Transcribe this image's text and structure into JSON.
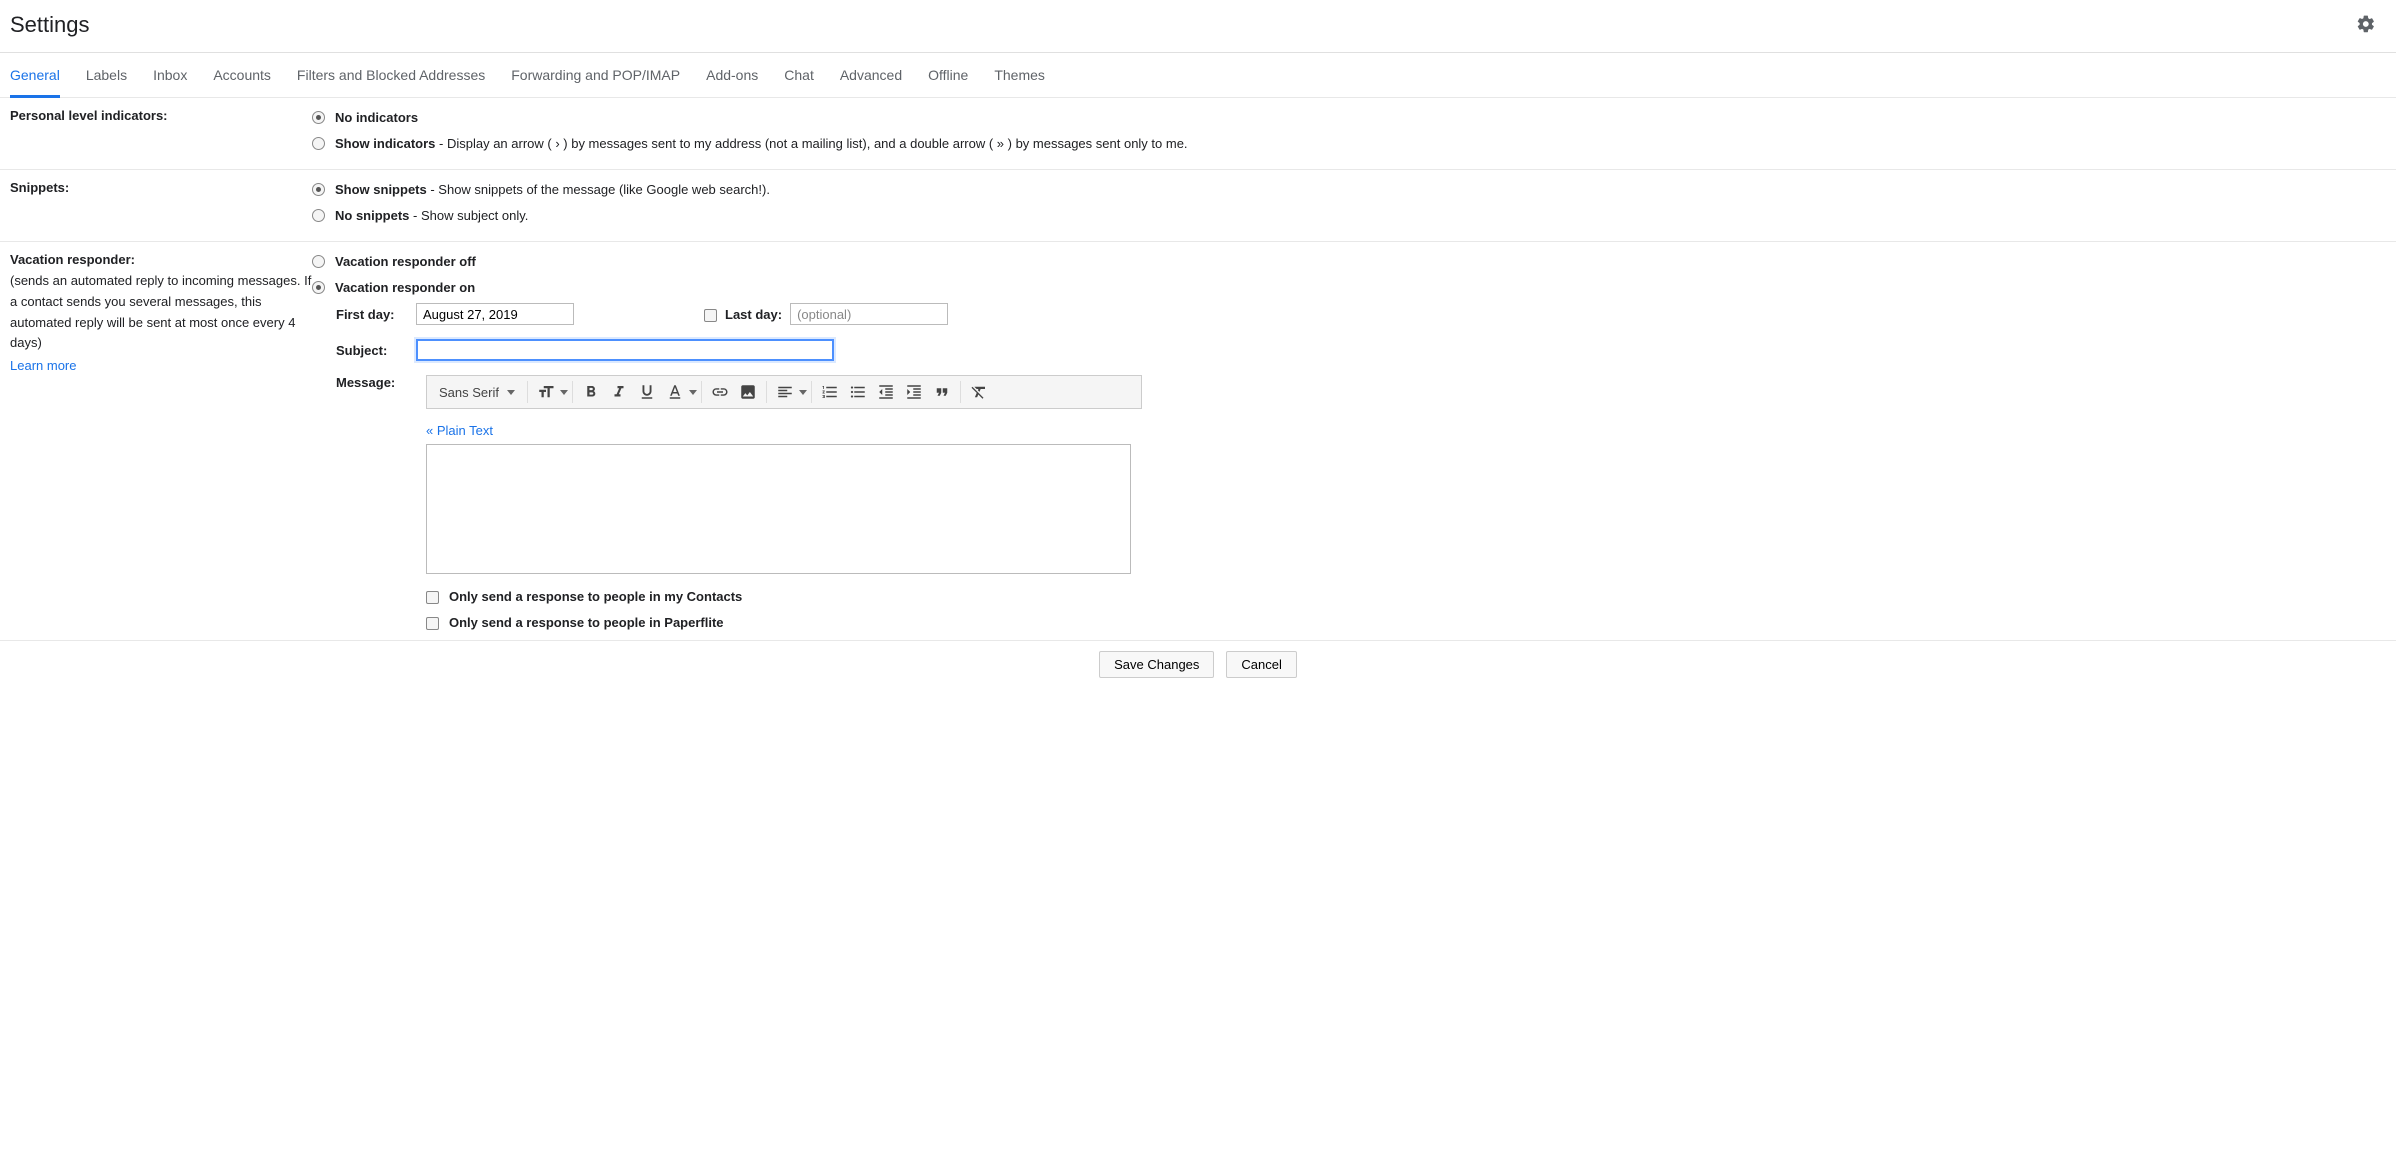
{
  "page_title": "Settings",
  "tabs": [
    "General",
    "Labels",
    "Inbox",
    "Accounts",
    "Filters and Blocked Addresses",
    "Forwarding and POP/IMAP",
    "Add-ons",
    "Chat",
    "Advanced",
    "Offline",
    "Themes"
  ],
  "active_tab_index": 0,
  "personal_indicators": {
    "label": "Personal level indicators:",
    "opt1": "No indicators",
    "opt2_bold": "Show indicators",
    "opt2_rest": " - Display an arrow ( › ) by messages sent to my address (not a mailing list), and a double arrow ( » ) by messages sent only to me."
  },
  "snippets": {
    "label": "Snippets:",
    "opt1_bold": "Show snippets",
    "opt1_rest": " - Show snippets of the message (like Google web search!).",
    "opt2_bold": "No snippets",
    "opt2_rest": " - Show subject only."
  },
  "vacation": {
    "label": "Vacation responder:",
    "desc": "(sends an automated reply to incoming messages. If a contact sends you several messages, this automated reply will be sent at most once every 4 days)",
    "learn_more": "Learn more",
    "opt_off": "Vacation responder off",
    "opt_on": "Vacation responder on",
    "first_day_label": "First day:",
    "first_day_value": "August 27, 2019",
    "last_day_label": "Last day:",
    "last_day_placeholder": "(optional)",
    "subject_label": "Subject:",
    "subject_value": "",
    "message_label": "Message:",
    "font_dropdown": "Sans Serif",
    "plain_text_link": "« Plain Text",
    "check1": "Only send a response to people in my Contacts",
    "check2": "Only send a response to people in Paperflite"
  },
  "footer": {
    "save": "Save Changes",
    "cancel": "Cancel"
  }
}
